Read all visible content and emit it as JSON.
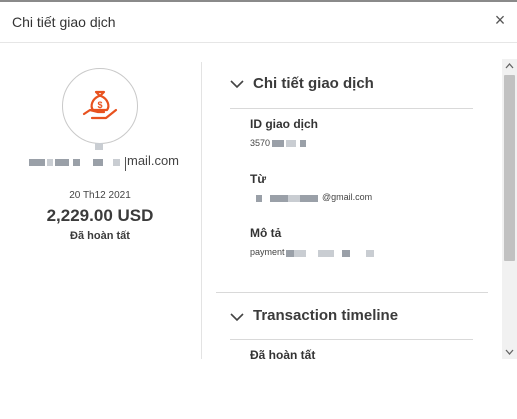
{
  "dialog": {
    "title": "Chi tiết giao dịch",
    "close_icon": "close-icon"
  },
  "summary": {
    "avatar_icon": "money-bag-hand-icon",
    "accent_color": "#e8521f",
    "email_suffix": "mail.com",
    "date": "20 Th12 2021",
    "amount": "2,229.00 USD",
    "status": "Đã hoàn tất"
  },
  "details": {
    "section_title": "Chi tiết giao dịch",
    "fields": [
      {
        "label": "ID giao dịch",
        "value": "3570"
      },
      {
        "label": "Từ",
        "value": "@gmail.com"
      },
      {
        "label": "Mô tả",
        "value": "payment"
      }
    ]
  },
  "timeline": {
    "section_title": "Transaction timeline",
    "first_item": "Đã hoàn tất"
  }
}
